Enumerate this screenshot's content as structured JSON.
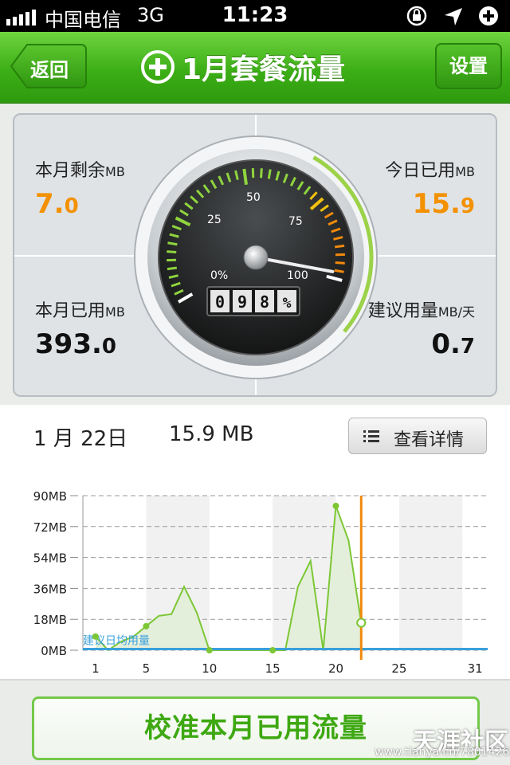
{
  "statusbar": {
    "carrier": "中国电信",
    "network": "3G",
    "time": "11:23"
  },
  "navbar": {
    "back_label": "返回",
    "title": "1月套餐流量",
    "settings_label": "设置",
    "title_icon": "plus-circle-icon"
  },
  "stats": {
    "remaining": {
      "label": "本月剩余",
      "unit": "MB",
      "int": "7.",
      "dec": "0"
    },
    "today_used": {
      "label": "今日已用",
      "unit": "MB",
      "int": "15.",
      "dec": "9"
    },
    "month_used": {
      "label": "本月已用",
      "unit": "MB",
      "int": "393.",
      "dec": "0"
    },
    "suggested": {
      "label": "建议用量",
      "unit": "MB/天",
      "int": "0.",
      "dec": "7"
    }
  },
  "gauge": {
    "scale_labels": [
      "0%",
      "25",
      "50",
      "75",
      "100"
    ],
    "odometer": [
      "0",
      "9",
      "8",
      "%"
    ],
    "percent": 98,
    "colors": {
      "green": "#8fd43e",
      "yellow": "#f2c20f",
      "orange": "#f08a0c",
      "needle": "#e8e8e8"
    }
  },
  "date_row": {
    "date": "1 月 22日",
    "daily_usage": "15.9 MB",
    "detail_label": "查看详情",
    "detail_icon": "list-icon"
  },
  "chart_data": {
    "type": "area",
    "x": [
      1,
      2,
      3,
      4,
      5,
      6,
      7,
      8,
      9,
      10,
      11,
      12,
      13,
      14,
      15,
      16,
      17,
      18,
      19,
      20,
      21,
      22
    ],
    "values": [
      8,
      0,
      5,
      8,
      14,
      20,
      21,
      37,
      22,
      0,
      0,
      0,
      0,
      0,
      0,
      0,
      37,
      52,
      0,
      84,
      64,
      16
    ],
    "marker_days": [
      1,
      5,
      10,
      15,
      20,
      22
    ],
    "current_day": 22,
    "x_ticks": [
      "1",
      "5",
      "10",
      "15",
      "20",
      "25",
      "31"
    ],
    "x_tick_values": [
      1,
      5,
      10,
      15,
      20,
      25,
      31
    ],
    "y_ticks": [
      "0MB",
      "18MB",
      "36MB",
      "54MB",
      "72MB",
      "90MB"
    ],
    "y_tick_values": [
      0,
      18,
      36,
      54,
      72,
      90
    ],
    "ylim": [
      0,
      90
    ],
    "xlim": [
      0,
      32
    ],
    "reference_label": "建议日均用量",
    "reference_value": 0.7,
    "colors": {
      "line": "#7cc735",
      "fill": "#e4efdb",
      "reference": "#3aa0dc",
      "today": "#f08a0c",
      "band": "#f1f1f1"
    }
  },
  "bottom": {
    "calibrate_label": "校准本月已用流量",
    "watermark": "天涯社区",
    "watermark_url": "www.tianya.cn/78014261"
  }
}
